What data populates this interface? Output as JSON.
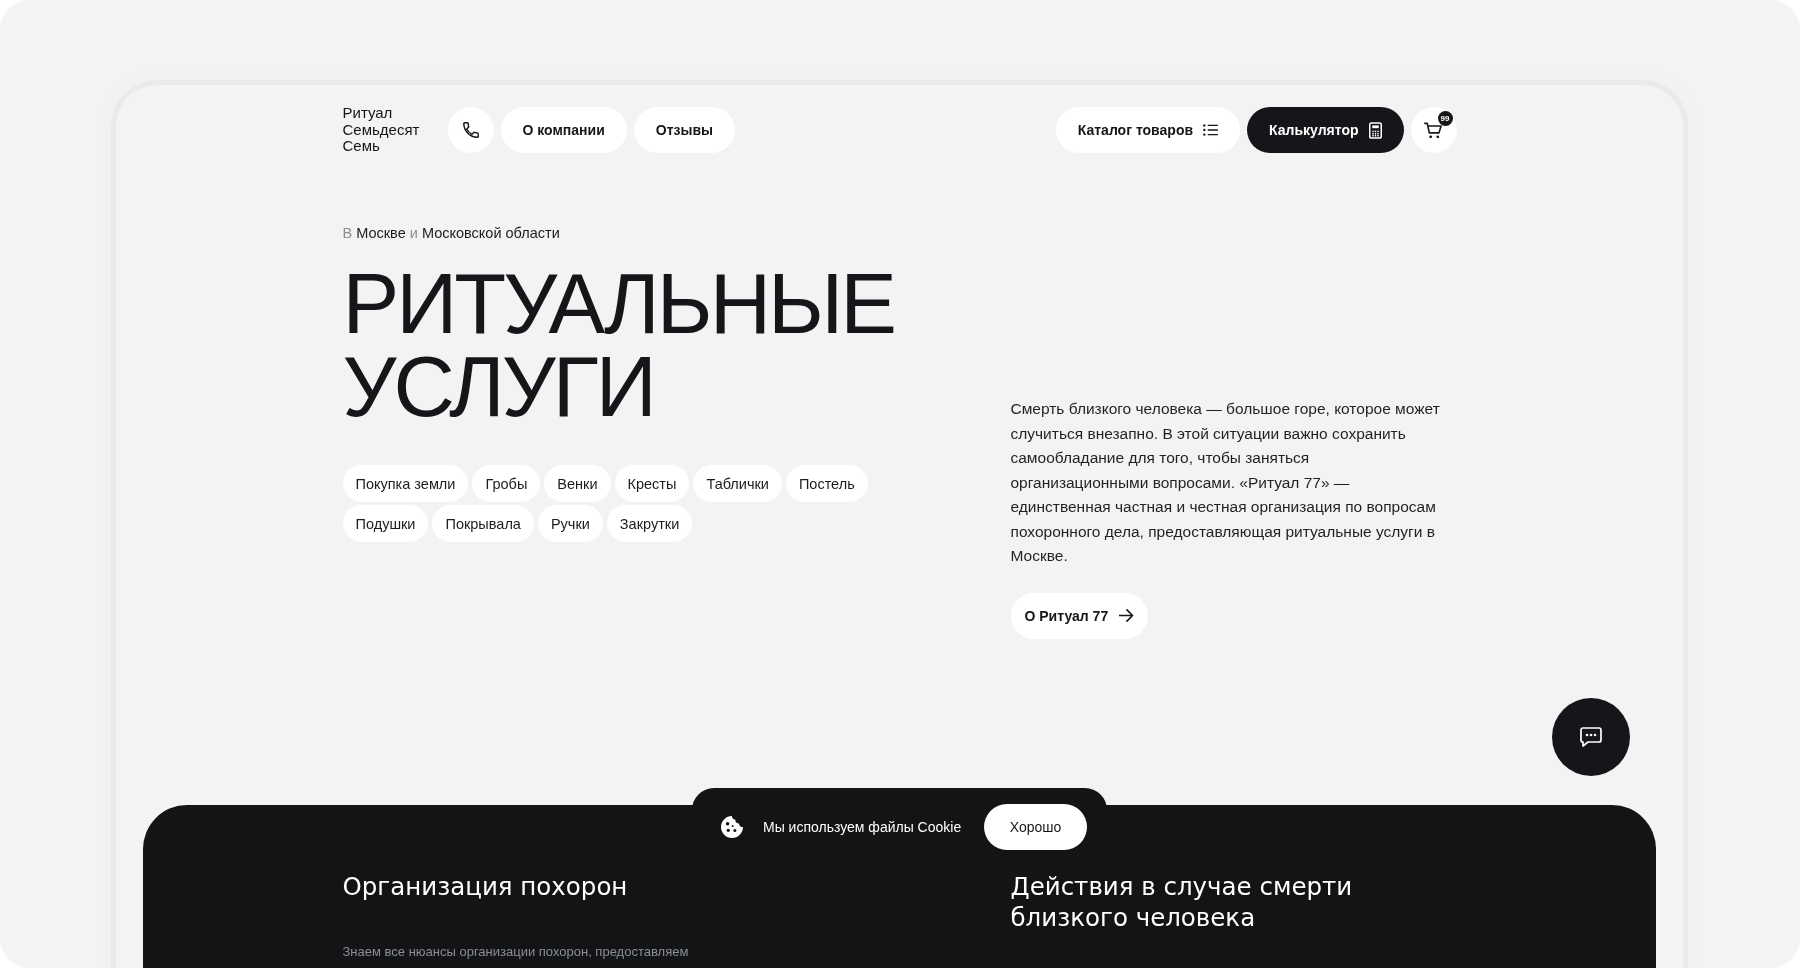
{
  "logo": {
    "lines": [
      "Ритуал",
      "Семьдесят",
      "Семь"
    ]
  },
  "nav": [
    {
      "label": "О компании"
    },
    {
      "label": "Отзывы"
    }
  ],
  "actions": [
    {
      "label": "Каталог товаров",
      "kind": "catalog"
    },
    {
      "label": "Калькулятор",
      "kind": "calculator"
    }
  ],
  "cart": {
    "badge": "99"
  },
  "hero": {
    "region": [
      {
        "text": "В",
        "muted": true
      },
      {
        "text": "Москве",
        "muted": false
      },
      {
        "text": "и",
        "muted": true
      },
      {
        "text": "Московской области",
        "muted": false
      }
    ],
    "title": "РИТУАЛЬНЫЕ УСЛУГИ",
    "tags": [
      "Покупка земли",
      "Гробы",
      "Венки",
      "Кресты",
      "Таблички",
      "Постель",
      "Подушки",
      "Покрывала",
      "Ручки",
      "Закрутки"
    ],
    "description": "Смерть близкого человека — большое горе, которое может случиться внезапно. В этой ситуации важно сохранить самообладание для того, чтобы заняться организационными вопросами. «Ритуал 77» — единственная частная и честная организация по вопросам похоронного дела, предоставляющая ритуальные услуги в Москве.",
    "about_button": "О Ритуал 77"
  },
  "cookie_banner": {
    "text": "Мы используем файлы Cookie",
    "button": "Хорошо"
  },
  "sections": [
    {
      "title": "Организация похорон",
      "text": "Знаем все нюансы организации похорон, предоставляем"
    },
    {
      "title": "Действия в случае смерти близкого человека"
    }
  ]
}
